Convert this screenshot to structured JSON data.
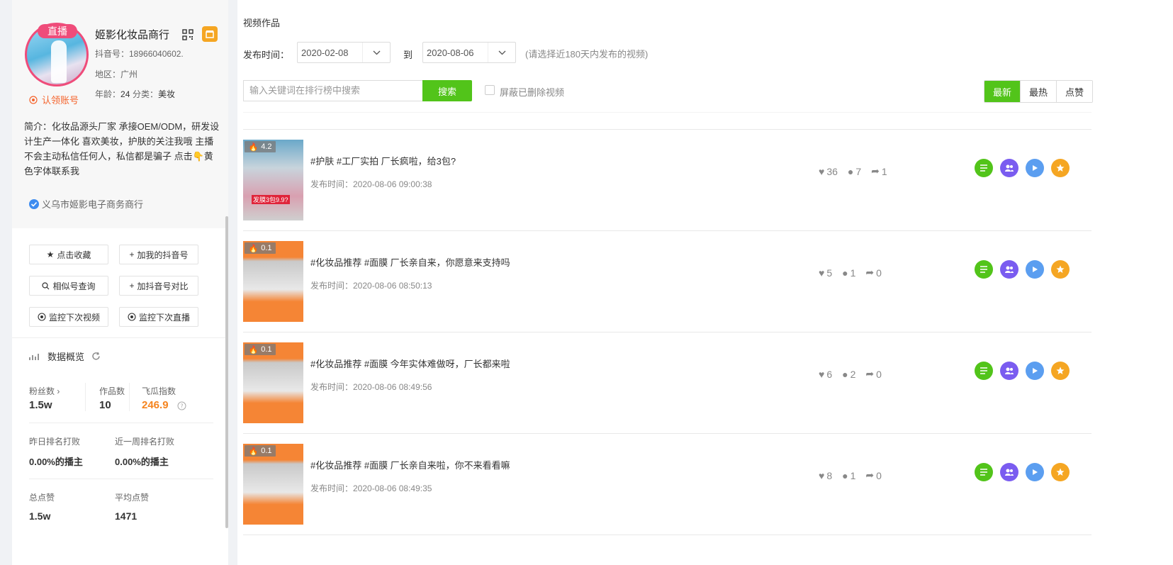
{
  "profile": {
    "live_label": "直播",
    "nickname": "姬影化妆品商行",
    "douyin_id": "抖音号：18966040602.",
    "region": "地区：广州",
    "claim_label": "认领账号",
    "age_label": "年龄：",
    "age_value": "24",
    "category_label": "分类：",
    "category_value": "美妆",
    "bio": "简介：化妆品源头厂家 承接OEM/ODM，研发设计生产一体化 喜欢美妆，护肤的关注我哦 主播不会主动私信任何人，私信都是骗子 点击👇黄色字体联系我",
    "company": "义乌市姬影电子商务商行"
  },
  "actions": {
    "favorite": "点击收藏",
    "add_my": "加我的抖音号",
    "similar": "相似号查询",
    "compare": "加抖音号对比",
    "monitor_video": "监控下次视频",
    "monitor_live": "监控下次直播"
  },
  "stats": {
    "title": "数据概览",
    "fans_label": "粉丝数",
    "fans_value": "1.5w",
    "works_label": "作品数",
    "works_value": "10",
    "index_label": "飞瓜指数",
    "index_value": "246.9",
    "yesterday_label": "昨日排名打败",
    "yesterday_value": "0.00%的播主",
    "week_label": "近一周排名打败",
    "week_value": "0.00%的播主",
    "likes_label": "总点赞",
    "likes_value": "1.5w",
    "avg_label": "平均点赞",
    "avg_value": "1471"
  },
  "filters": {
    "section_title": "视频作品",
    "publish_label": "发布时间：",
    "date_from": "2020-02-08",
    "to_label": "到",
    "date_to": "2020-08-06",
    "hint": "(请选择近180天内发布的视频)",
    "search_placeholder": "输入关键词在排行榜中搜索",
    "search_button": "搜索",
    "hide_deleted": "屏蔽已删除视频",
    "sort_latest": "最新",
    "sort_hot": "最热",
    "sort_likes": "点赞"
  },
  "videos": [
    {
      "score": "4.2",
      "overlay": "发膜3包9.9?",
      "title": "#护肤 #工厂实拍 厂长疯啦，给3包?",
      "date": "发布时间：2020-08-06 09:00:38",
      "likes": "36",
      "comments": "7",
      "shares": "1"
    },
    {
      "score": "0.1",
      "overlay": "",
      "title": "#化妆品推荐 #面膜 厂长亲自来，你愿意来支持吗",
      "date": "发布时间：2020-08-06 08:50:13",
      "likes": "5",
      "comments": "1",
      "shares": "0"
    },
    {
      "score": "0.1",
      "overlay": "",
      "title": "#化妆品推荐 #面膜 今年实体难做呀，厂长都来啦",
      "date": "发布时间：2020-08-06 08:49:56",
      "likes": "6",
      "comments": "2",
      "shares": "0"
    },
    {
      "score": "0.1",
      "overlay": "",
      "title": "#化妆品推荐 #面膜 厂长亲自来啦，你不来看看嘛",
      "date": "发布时间：2020-08-06 08:49:35",
      "likes": "8",
      "comments": "1",
      "shares": "0"
    }
  ],
  "colors": {
    "accent_green": "#52c41a",
    "orange": "#f5a623",
    "purple": "#7a5cf0",
    "blue": "#5b9ef0",
    "pink": "#ef4c7a"
  }
}
